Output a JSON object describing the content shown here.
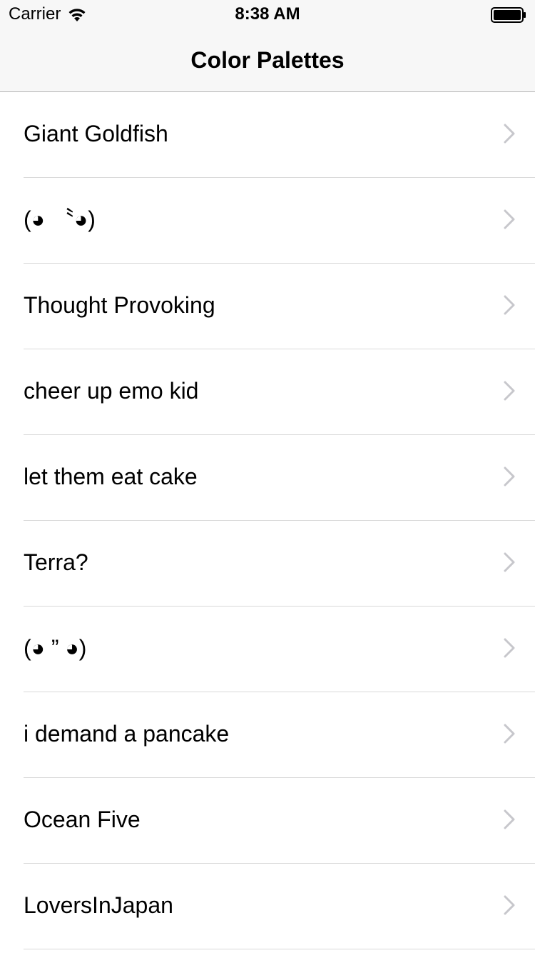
{
  "status_bar": {
    "carrier": "Carrier",
    "time": "8:38 AM",
    "icons": [
      "wifi-icon",
      "battery-icon"
    ]
  },
  "nav": {
    "title": "Color Palettes"
  },
  "list": {
    "accessory_icon": "chevron-right-icon",
    "chevron_color": "#c7c7cc",
    "separator_color": "#d9d9d9",
    "items": [
      {
        "label": "Giant Goldfish"
      },
      {
        "label": "(◕ 〝◕)"
      },
      {
        "label": "Thought Provoking"
      },
      {
        "label": "cheer up emo kid"
      },
      {
        "label": "let them eat cake"
      },
      {
        "label": "Terra?"
      },
      {
        "label": "(◕ ” ◕)"
      },
      {
        "label": "i demand a pancake"
      },
      {
        "label": "Ocean Five"
      },
      {
        "label": "LoversInJapan"
      }
    ]
  }
}
